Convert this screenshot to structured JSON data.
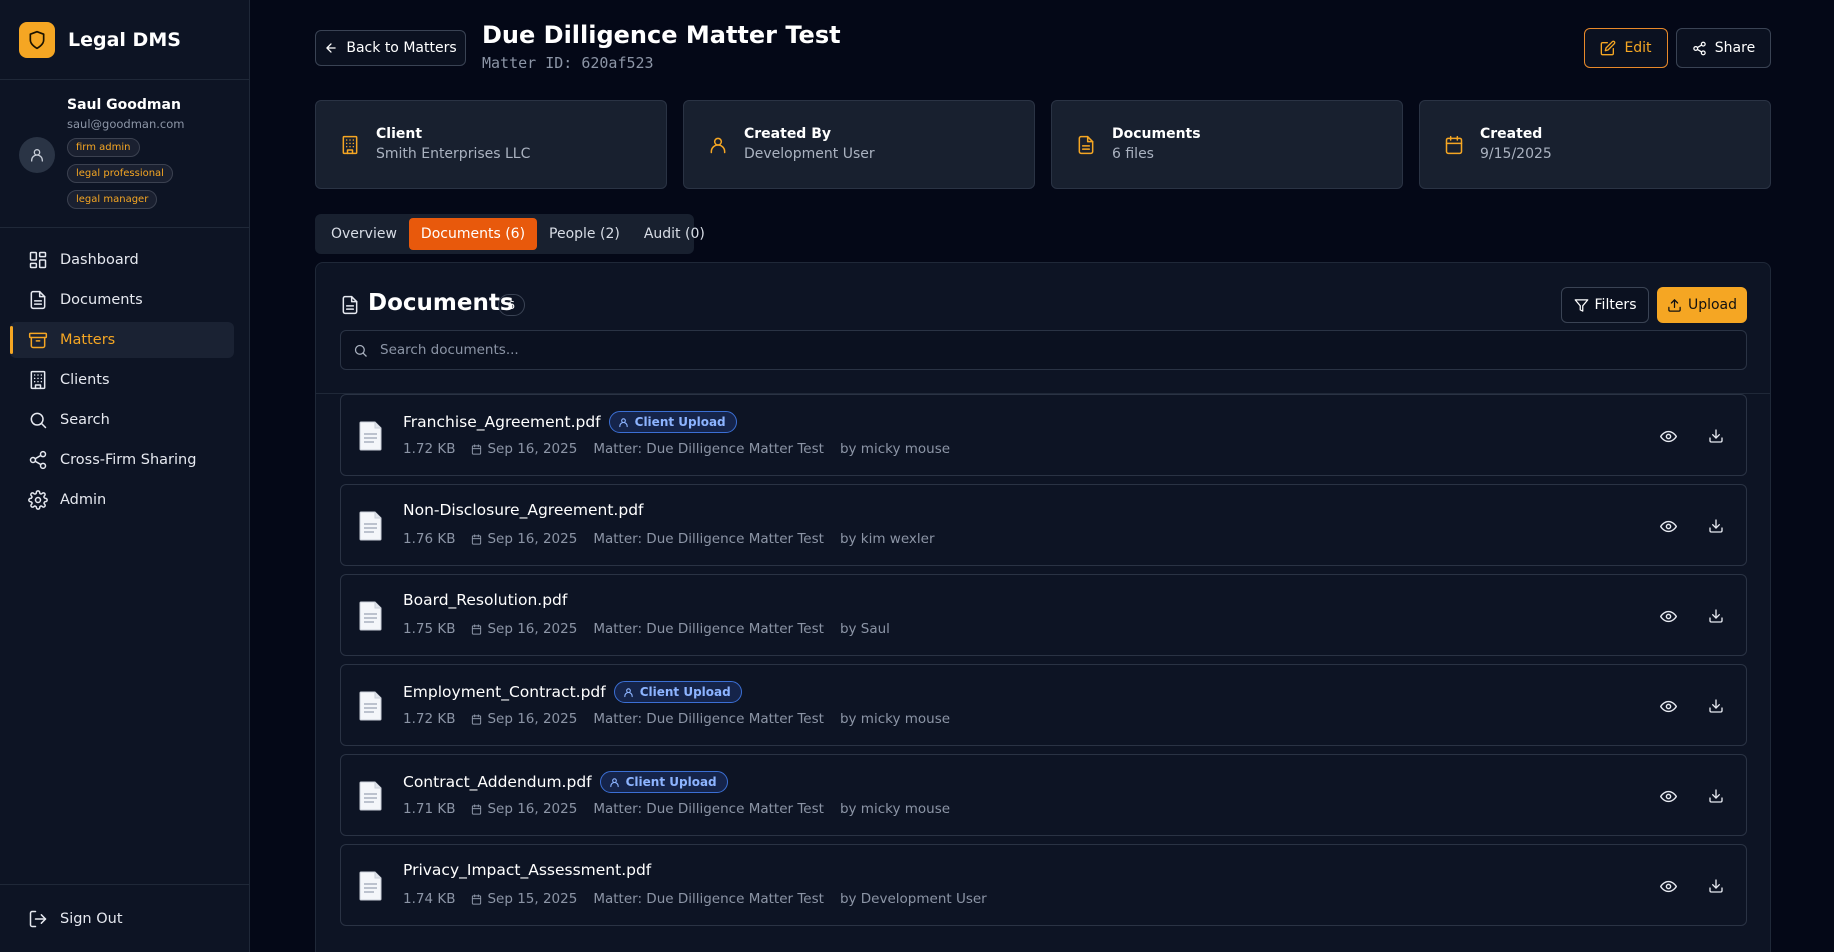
{
  "app": {
    "name": "Legal DMS"
  },
  "user": {
    "name": "Saul Goodman",
    "email": "saul@goodman.com",
    "roles": [
      "firm admin",
      "legal professional",
      "legal manager"
    ]
  },
  "nav": {
    "items": [
      {
        "label": "Dashboard",
        "icon": "dashboard-icon"
      },
      {
        "label": "Documents",
        "icon": "document-icon"
      },
      {
        "label": "Matters",
        "icon": "archive-icon",
        "active": true
      },
      {
        "label": "Clients",
        "icon": "building-icon"
      },
      {
        "label": "Search",
        "icon": "search-icon"
      },
      {
        "label": "Cross-Firm Sharing",
        "icon": "share-icon"
      },
      {
        "label": "Admin",
        "icon": "gear-icon"
      }
    ],
    "sign_out": "Sign Out"
  },
  "header": {
    "back_label": "Back to Matters",
    "title": "Due Dilligence Matter Test",
    "matter_id": "Matter ID: 620af523",
    "edit_label": "Edit",
    "share_label": "Share"
  },
  "cards": [
    {
      "label": "Client",
      "value": "Smith Enterprises LLC",
      "icon": "building-icon"
    },
    {
      "label": "Created By",
      "value": "Development User",
      "icon": "user-icon"
    },
    {
      "label": "Documents",
      "value": "6 files",
      "icon": "file-text-icon"
    },
    {
      "label": "Created",
      "value": "9/15/2025",
      "icon": "calendar-icon"
    }
  ],
  "tabs": [
    {
      "label": "Overview"
    },
    {
      "label": "Documents (6)",
      "active": true
    },
    {
      "label": "People (2)"
    },
    {
      "label": "Audit (0)"
    }
  ],
  "documents_panel": {
    "title": "Documents",
    "count": "6",
    "filters_label": "Filters",
    "upload_label": "Upload",
    "search_placeholder": "Search documents..."
  },
  "documents": [
    {
      "name": "Franchise_Agreement.pdf",
      "badge": "Client Upload",
      "size": "1.72 KB",
      "date": "Sep 16, 2025",
      "matter": "Matter: Due Dilligence Matter Test",
      "by": "by micky mouse"
    },
    {
      "name": "Non-Disclosure_Agreement.pdf",
      "badge": "",
      "size": "1.76 KB",
      "date": "Sep 16, 2025",
      "matter": "Matter: Due Dilligence Matter Test",
      "by": "by kim wexler"
    },
    {
      "name": "Board_Resolution.pdf",
      "badge": "",
      "size": "1.75 KB",
      "date": "Sep 16, 2025",
      "matter": "Matter: Due Dilligence Matter Test",
      "by": "by Saul"
    },
    {
      "name": "Employment_Contract.pdf",
      "badge": "Client Upload",
      "size": "1.72 KB",
      "date": "Sep 16, 2025",
      "matter": "Matter: Due Dilligence Matter Test",
      "by": "by micky mouse"
    },
    {
      "name": "Contract_Addendum.pdf",
      "badge": "Client Upload",
      "size": "1.71 KB",
      "date": "Sep 16, 2025",
      "matter": "Matter: Due Dilligence Matter Test",
      "by": "by micky mouse"
    },
    {
      "name": "Privacy_Impact_Assessment.pdf",
      "badge": "",
      "size": "1.74 KB",
      "date": "Sep 15, 2025",
      "matter": "Matter: Due Dilligence Matter Test",
      "by": "by Development User"
    }
  ],
  "colors": {
    "accent": "#f5a623",
    "active_tab": "#e8590c",
    "background": "#040817",
    "sidebar": "#0d1424",
    "card": "#18202f",
    "client_badge": "#3b6fd4"
  }
}
